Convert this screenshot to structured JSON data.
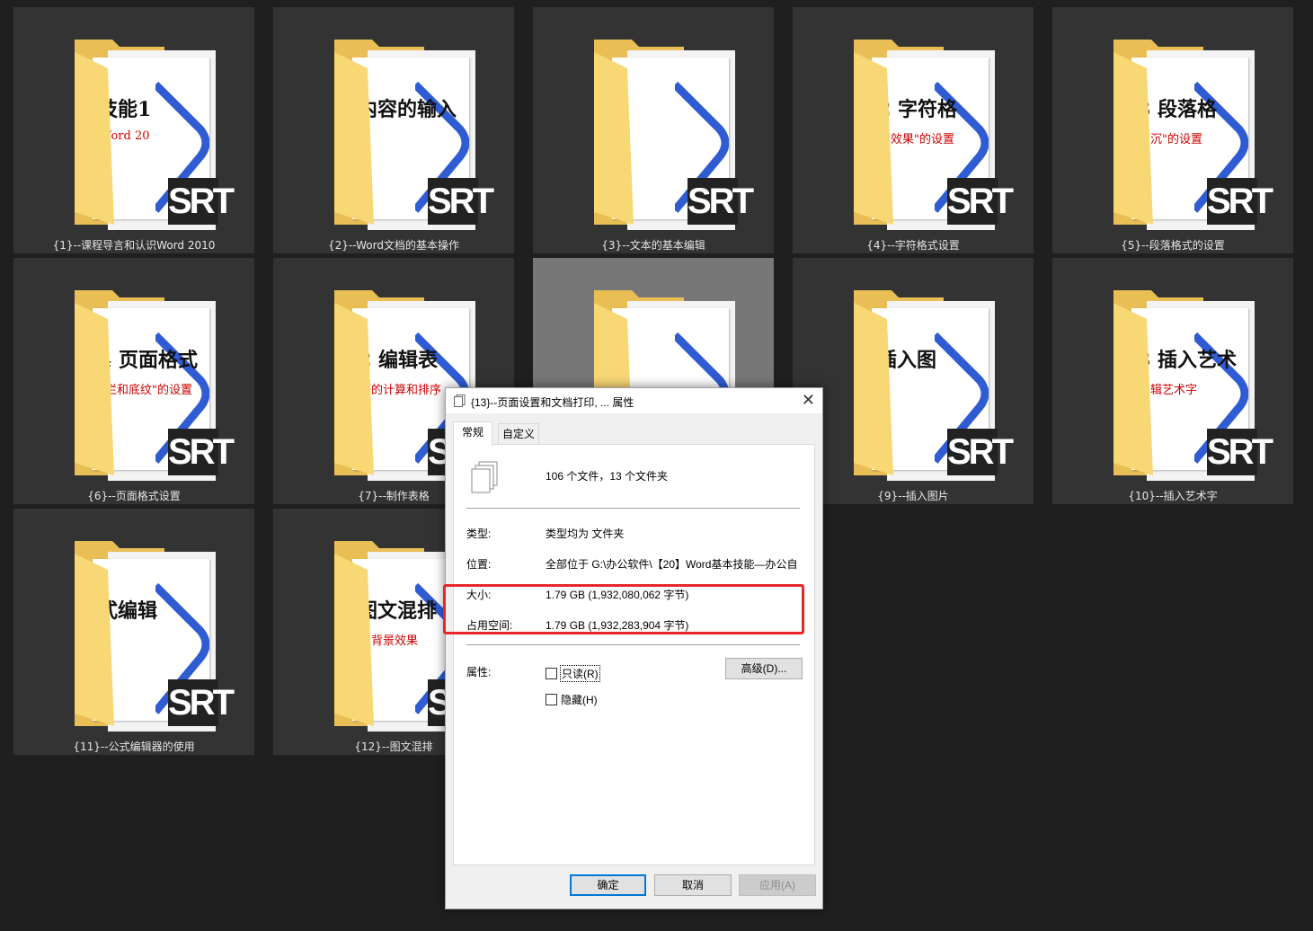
{
  "folders": [
    {
      "label": "{1}--课程导言和认识Word 2010",
      "doc_title": "技能1",
      "doc_sub": "Word 20"
    },
    {
      "label": "{2}--Word文档的基本操作",
      "doc_title": "内容的输入",
      "doc_sub": ""
    },
    {
      "label": "{3}--文本的基本编辑",
      "doc_title": "",
      "doc_sub": ""
    },
    {
      "label": "{4}--字符格式设置",
      "doc_title": "2 字符格",
      "doc_sub": "字效果\"的设置"
    },
    {
      "label": "{5}--段落格式的设置",
      "doc_title": "3 段落格",
      "doc_sub": "下沉\"的设置"
    },
    {
      "label": "{6}--页面格式设置",
      "doc_title": "4 页面格式",
      "doc_sub": "\"栏和底纹\"的设置"
    },
    {
      "label": "{7}--制作表格",
      "doc_title": "2 编辑表",
      "doc_sub": "据的计算和排序"
    },
    {
      "label": "",
      "doc_title": "",
      "doc_sub": ""
    },
    {
      "label": "{9}--插入图片",
      "doc_title": "插入图",
      "doc_sub": ""
    },
    {
      "label": "{10}--插入艺术字",
      "doc_title": "3 插入艺术",
      "doc_sub": "编辑艺术字"
    },
    {
      "label": "{11}--公式编辑器的使用",
      "doc_title": "式编辑",
      "doc_sub": ""
    },
    {
      "label": "{12}--图文混排",
      "doc_title": "图文混排",
      "doc_sub": "印背景效果"
    }
  ],
  "srt_text": "SRT",
  "dialog": {
    "title": "{13}--页面设置和文档打印, ... 属性",
    "close": "✕",
    "tabs": [
      "常规",
      "自定义"
    ],
    "summary": "106 个文件，13 个文件夹",
    "type_label": "类型:",
    "type_value": "类型均为 文件夹",
    "location_label": "位置:",
    "location_value": "全部位于 G:\\办公软件\\【20】Word基本技能—办公自",
    "size_label": "大小:",
    "size_value": "1.79 GB (1,932,080,062 字节)",
    "disk_label": "占用空间:",
    "disk_value": "1.79 GB (1,932,283,904 字节)",
    "attr_label": "属性:",
    "readonly": "只读(R)",
    "hidden": "隐藏(H)",
    "advanced": "高级(D)...",
    "ok": "确定",
    "cancel": "取消",
    "apply": "应用(A)"
  },
  "colors": {
    "highlight": "#e8262a",
    "accent": "#0078d7",
    "folder": "#f8d775"
  }
}
